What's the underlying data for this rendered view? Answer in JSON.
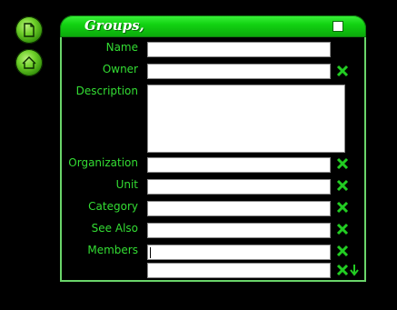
{
  "sidebar": {
    "new_icon": "document-icon",
    "home_icon": "house-icon"
  },
  "window": {
    "title": "Groups,"
  },
  "form": {
    "fields": [
      {
        "label": "Name",
        "value": ""
      },
      {
        "label": "Owner",
        "value": ""
      },
      {
        "label": "Description",
        "value": ""
      },
      {
        "label": "Organization",
        "value": ""
      },
      {
        "label": "Unit",
        "value": ""
      },
      {
        "label": "Category",
        "value": ""
      },
      {
        "label": "See Also",
        "value": ""
      },
      {
        "label": "Members",
        "value": ""
      }
    ],
    "remove_icon": "x-remove-icon",
    "add_icon": "add-arrow-icon"
  },
  "colors": {
    "background": "#000000",
    "accent": "#22cc22",
    "label": "#33dd33",
    "border": "#6ad56a"
  }
}
